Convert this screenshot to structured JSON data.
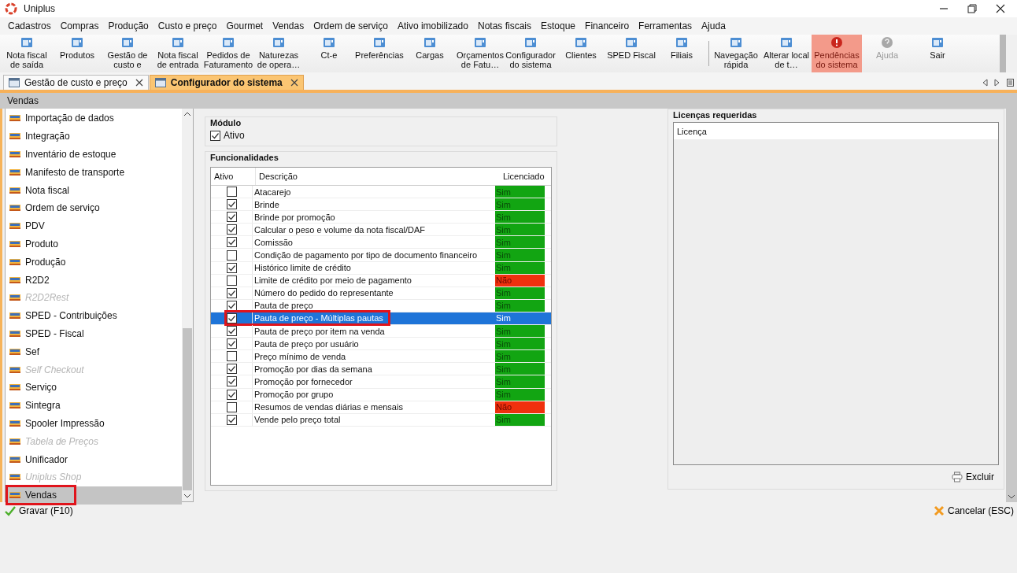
{
  "window": {
    "title": "Uniplus"
  },
  "menu": [
    "Cadastros",
    "Compras",
    "Produção",
    "Custo e preço",
    "Gourmet",
    "Vendas",
    "Ordem de serviço",
    "Ativo imobilizado",
    "Notas fiscais",
    "Estoque",
    "Financeiro",
    "Ferramentas",
    "Ajuda"
  ],
  "toolbar": {
    "groups": [
      [
        {
          "label": "Nota fiscal de saída",
          "alert": false,
          "disabled": false
        },
        {
          "label": "Produtos",
          "alert": false,
          "disabled": false
        },
        {
          "label": "Gestão de custo e",
          "alert": false,
          "disabled": false
        },
        {
          "label": "Nota fiscal de entrada",
          "alert": false,
          "disabled": false
        },
        {
          "label": "Pedidos de Faturamento",
          "alert": false,
          "disabled": false
        },
        {
          "label": "Naturezas de opera…",
          "alert": false,
          "disabled": false
        },
        {
          "label": "Ct-e",
          "alert": false,
          "disabled": false
        },
        {
          "label": "Preferências",
          "alert": false,
          "disabled": false
        },
        {
          "label": "Cargas",
          "alert": false,
          "disabled": false
        },
        {
          "label": "Orçamentos de Fatu…",
          "alert": false,
          "disabled": false
        },
        {
          "label": "Configurador do sistema",
          "alert": false,
          "disabled": false
        },
        {
          "label": "Clientes",
          "alert": false,
          "disabled": false
        },
        {
          "label": "SPED Fiscal",
          "alert": false,
          "disabled": false
        },
        {
          "label": "Filiais",
          "alert": false,
          "disabled": false
        }
      ],
      [
        {
          "label": "Navegação rápida",
          "alert": false,
          "disabled": false
        },
        {
          "label": "Alterar local de t…",
          "alert": false,
          "disabled": false
        },
        {
          "label": "Pendências do sistema",
          "alert": true,
          "disabled": false
        },
        {
          "label": "Ajuda",
          "alert": false,
          "disabled": true
        },
        {
          "label": "Sair",
          "alert": false,
          "disabled": false
        }
      ]
    ]
  },
  "tabs": [
    {
      "label": "Gestão de custo e preço",
      "selected": false
    },
    {
      "label": "Configurador do sistema",
      "selected": true
    }
  ],
  "section_header": "Vendas",
  "sidebar": {
    "items": [
      {
        "label": "Importação de dados",
        "disabled": false,
        "selected": false,
        "highlighted": false
      },
      {
        "label": "Integração",
        "disabled": false,
        "selected": false,
        "highlighted": false
      },
      {
        "label": "Inventário de estoque",
        "disabled": false,
        "selected": false,
        "highlighted": false
      },
      {
        "label": "Manifesto de transporte",
        "disabled": false,
        "selected": false,
        "highlighted": false
      },
      {
        "label": "Nota fiscal",
        "disabled": false,
        "selected": false,
        "highlighted": false
      },
      {
        "label": "Ordem de serviço",
        "disabled": false,
        "selected": false,
        "highlighted": false
      },
      {
        "label": "PDV",
        "disabled": false,
        "selected": false,
        "highlighted": false
      },
      {
        "label": "Produto",
        "disabled": false,
        "selected": false,
        "highlighted": false
      },
      {
        "label": "Produção",
        "disabled": false,
        "selected": false,
        "highlighted": false
      },
      {
        "label": "R2D2",
        "disabled": false,
        "selected": false,
        "highlighted": false
      },
      {
        "label": "R2D2Rest",
        "disabled": true,
        "selected": false,
        "highlighted": false
      },
      {
        "label": "SPED - Contribuições",
        "disabled": false,
        "selected": false,
        "highlighted": false
      },
      {
        "label": "SPED - Fiscal",
        "disabled": false,
        "selected": false,
        "highlighted": false
      },
      {
        "label": "Sef",
        "disabled": false,
        "selected": false,
        "highlighted": false
      },
      {
        "label": "Self Checkout",
        "disabled": true,
        "selected": false,
        "highlighted": false
      },
      {
        "label": "Serviço",
        "disabled": false,
        "selected": false,
        "highlighted": false
      },
      {
        "label": "Sintegra",
        "disabled": false,
        "selected": false,
        "highlighted": false
      },
      {
        "label": "Spooler Impressão",
        "disabled": false,
        "selected": false,
        "highlighted": false
      },
      {
        "label": "Tabela de Preços",
        "disabled": true,
        "selected": false,
        "highlighted": false
      },
      {
        "label": "Unificador",
        "disabled": false,
        "selected": false,
        "highlighted": false
      },
      {
        "label": "Uniplus Shop",
        "disabled": true,
        "selected": false,
        "highlighted": false
      },
      {
        "label": "Vendas",
        "disabled": false,
        "selected": true,
        "highlighted": true
      }
    ]
  },
  "module": {
    "title": "Módulo",
    "checkbox": {
      "label": "Ativo",
      "checked": true
    }
  },
  "features": {
    "title": "Funcionalidades",
    "columns": [
      "Ativo",
      "Descrição",
      "Licenciado"
    ],
    "rows": [
      {
        "checked": false,
        "description": "Atacarejo",
        "licensed": "Sim",
        "license_ok": true,
        "selected": false,
        "highlighted": false
      },
      {
        "checked": true,
        "description": "Brinde",
        "licensed": "Sim",
        "license_ok": true,
        "selected": false,
        "highlighted": false
      },
      {
        "checked": true,
        "description": "Brinde por promoção",
        "licensed": "Sim",
        "license_ok": true,
        "selected": false,
        "highlighted": false
      },
      {
        "checked": true,
        "description": "Calcular o peso e volume da nota fiscal/DAF",
        "licensed": "Sim",
        "license_ok": true,
        "selected": false,
        "highlighted": false
      },
      {
        "checked": true,
        "description": "Comissão",
        "licensed": "Sim",
        "license_ok": true,
        "selected": false,
        "highlighted": false
      },
      {
        "checked": false,
        "description": "Condição de pagamento por tipo de documento financeiro",
        "licensed": "Sim",
        "license_ok": true,
        "selected": false,
        "highlighted": false
      },
      {
        "checked": true,
        "description": "Histórico limite de crédito",
        "licensed": "Sim",
        "license_ok": true,
        "selected": false,
        "highlighted": false
      },
      {
        "checked": false,
        "description": "Limite de crédito por meio de pagamento",
        "licensed": "Não",
        "license_ok": false,
        "selected": false,
        "highlighted": false
      },
      {
        "checked": true,
        "description": "Número do pedido do representante",
        "licensed": "Sim",
        "license_ok": true,
        "selected": false,
        "highlighted": false
      },
      {
        "checked": true,
        "description": "Pauta de preço",
        "licensed": "Sim",
        "license_ok": true,
        "selected": false,
        "highlighted": false
      },
      {
        "checked": true,
        "description": "Pauta de preço - Múltiplas pautas",
        "licensed": "Sim",
        "license_ok": true,
        "selected": true,
        "highlighted": true
      },
      {
        "checked": true,
        "description": "Pauta de preço por item na venda",
        "licensed": "Sim",
        "license_ok": true,
        "selected": false,
        "highlighted": false
      },
      {
        "checked": true,
        "description": "Pauta de preço por usuário",
        "licensed": "Sim",
        "license_ok": true,
        "selected": false,
        "highlighted": false
      },
      {
        "checked": false,
        "description": "Preço mínimo de venda",
        "licensed": "Sim",
        "license_ok": true,
        "selected": false,
        "highlighted": false
      },
      {
        "checked": true,
        "description": "Promoção por dias da semana",
        "licensed": "Sim",
        "license_ok": true,
        "selected": false,
        "highlighted": false
      },
      {
        "checked": true,
        "description": "Promoção por fornecedor",
        "licensed": "Sim",
        "license_ok": true,
        "selected": false,
        "highlighted": false
      },
      {
        "checked": true,
        "description": "Promoção por grupo",
        "licensed": "Sim",
        "license_ok": true,
        "selected": false,
        "highlighted": false
      },
      {
        "checked": false,
        "description": "Resumos de vendas diárias e mensais",
        "licensed": "Não",
        "license_ok": false,
        "selected": false,
        "highlighted": false
      },
      {
        "checked": true,
        "description": "Vende pelo preço total",
        "licensed": "Sim",
        "license_ok": true,
        "selected": false,
        "highlighted": false
      }
    ]
  },
  "licenses": {
    "title": "Licenças requeridas",
    "column": "Licença",
    "delete_button": "Excluir"
  },
  "footer": {
    "save_button": "Gravar (F10)",
    "cancel_button": "Cancelar (ESC)"
  }
}
